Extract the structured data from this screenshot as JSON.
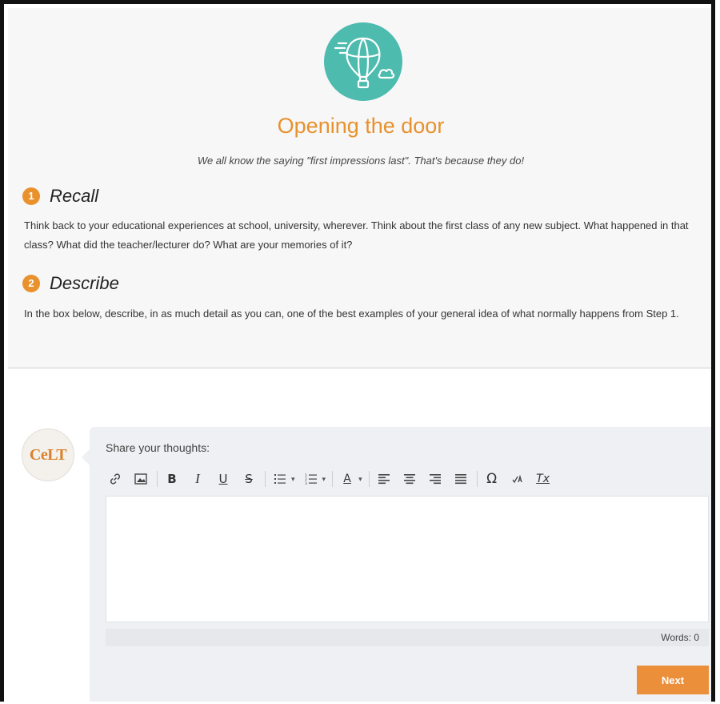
{
  "header": {
    "icon": "hot-air-balloon-icon",
    "title": "Opening the door",
    "subtitle": "We all know the saying \"first impressions last\". That's because they do!"
  },
  "steps": [
    {
      "number": "1",
      "label": "Recall",
      "text": "Think back to your educational experiences at school, university, wherever. Think about the first class of any new subject. What happened in that class? What did the teacher/lecturer do? What are your memories of it?"
    },
    {
      "number": "2",
      "label": "Describe",
      "text": "In the box below, describe, in as much detail as you can, one of the best examples of your general idea of what normally happens from Step 1."
    }
  ],
  "comment": {
    "avatar_text": "CeLT",
    "label": "Share your thoughts:",
    "toolbar": {
      "bold": "B",
      "italic": "I",
      "underline": "U",
      "strike": "S",
      "text_color": "A",
      "special_char": "Ω",
      "clear_format": "Tx"
    },
    "editor_value": "",
    "words_label": "Words: 0",
    "next_label": "Next"
  },
  "colors": {
    "accent_orange": "#e8912d",
    "teal": "#4dbbae",
    "button": "#ec8f3a"
  }
}
